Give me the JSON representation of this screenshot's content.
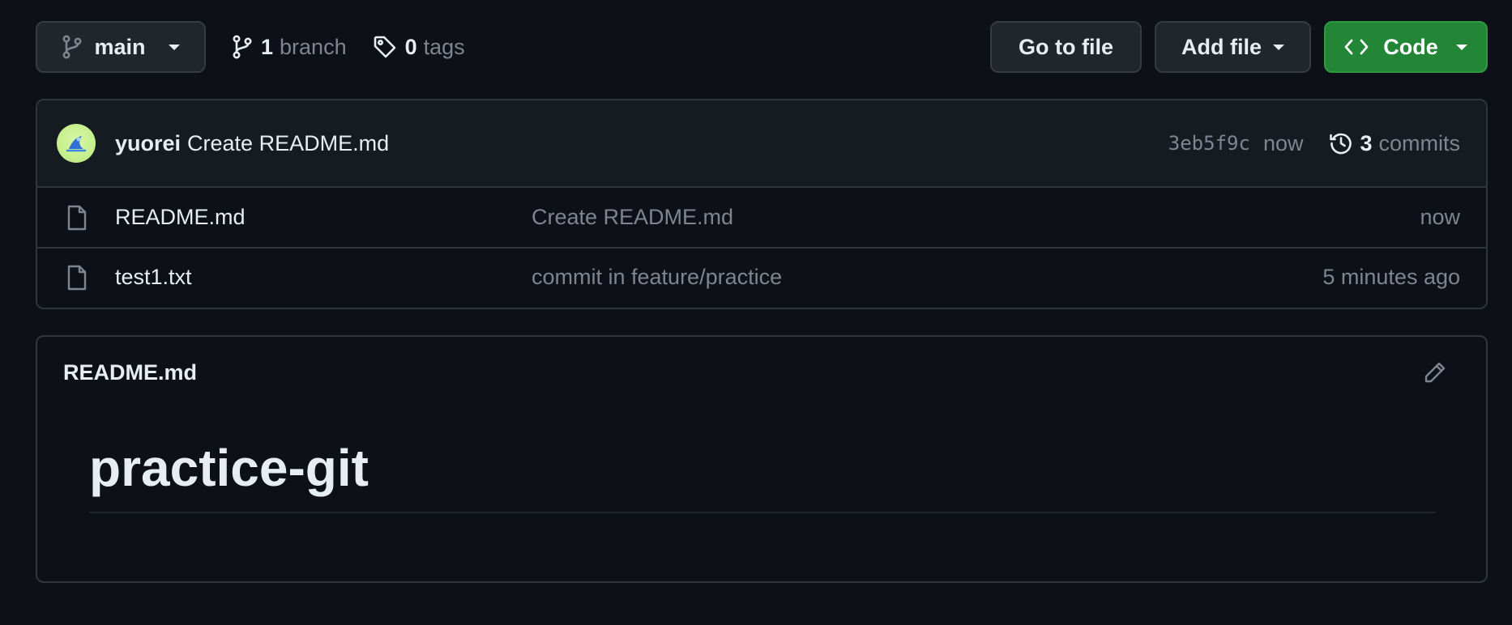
{
  "toolbar": {
    "branch_name": "main",
    "branch_count": "1",
    "branch_label": "branch",
    "tag_count": "0",
    "tag_label": "tags",
    "goto_file_label": "Go to file",
    "add_file_label": "Add file",
    "code_label": "Code"
  },
  "latest_commit": {
    "author": "yuorei",
    "message": "Create README.md",
    "sha": "3eb5f9c",
    "time": "now",
    "commit_count": "3",
    "commit_count_label": "commits"
  },
  "files": [
    {
      "name": "README.md",
      "last_commit": "Create README.md",
      "age": "now"
    },
    {
      "name": "test1.txt",
      "last_commit": "commit in feature/practice",
      "age": "5 minutes ago"
    }
  ],
  "readme": {
    "filename": "README.md",
    "heading": "practice-git"
  },
  "colors": {
    "background": "#0d1117",
    "panel": "#161b22",
    "border": "#30363d",
    "muted_text": "#7d8590",
    "primary_text": "#e6edf3",
    "code_button": "#238636"
  },
  "icons": {
    "branch": "git-branch-icon",
    "tag": "tag-icon",
    "code": "code-icon",
    "history": "history-icon",
    "file": "file-icon",
    "edit": "pencil-icon"
  }
}
